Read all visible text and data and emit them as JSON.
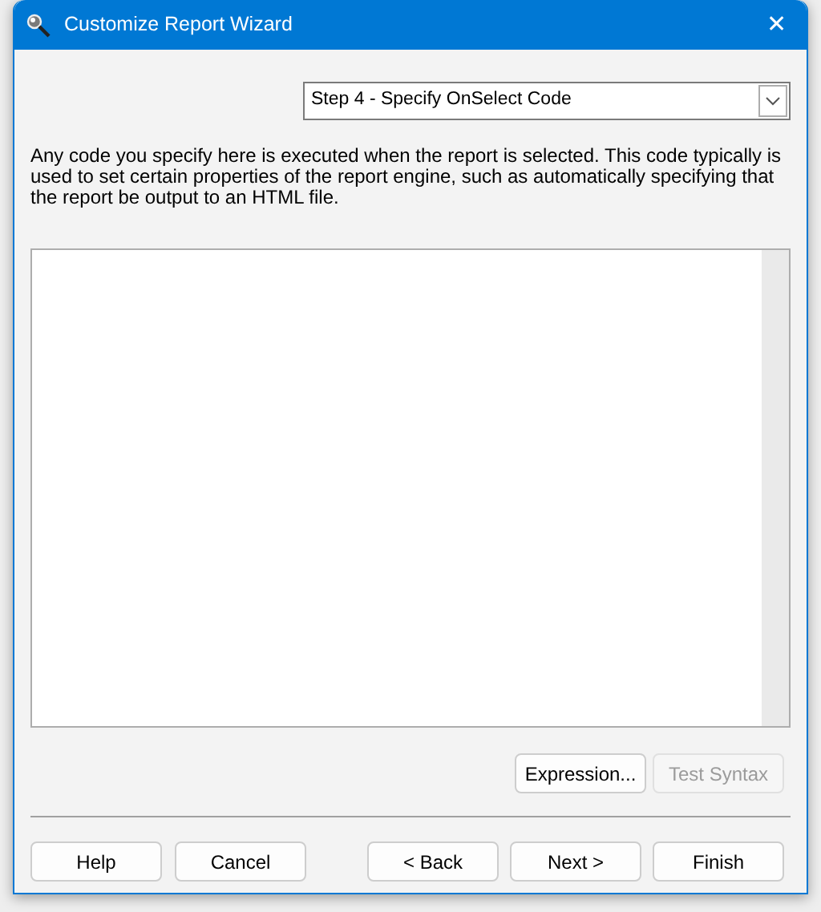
{
  "window": {
    "title": "Customize Report Wizard",
    "close": "✕"
  },
  "step_select": {
    "value": "Step 4 - Specify OnSelect Code"
  },
  "description": "Any code you specify here is executed when the report is selected. This code typically is used to set certain properties of the report engine, such as automatically specifying that the report be output to an HTML file.",
  "editor_buttons": [
    {
      "label": "Expression...",
      "disabled": false
    },
    {
      "label": "Test Syntax",
      "disabled": true
    }
  ],
  "footer_left_buttons": [
    {
      "label": "Help"
    },
    {
      "label": "Cancel"
    }
  ],
  "footer_right_buttons": [
    {
      "label": "< Back"
    },
    {
      "label": "Next >"
    },
    {
      "label": "Finish"
    }
  ]
}
